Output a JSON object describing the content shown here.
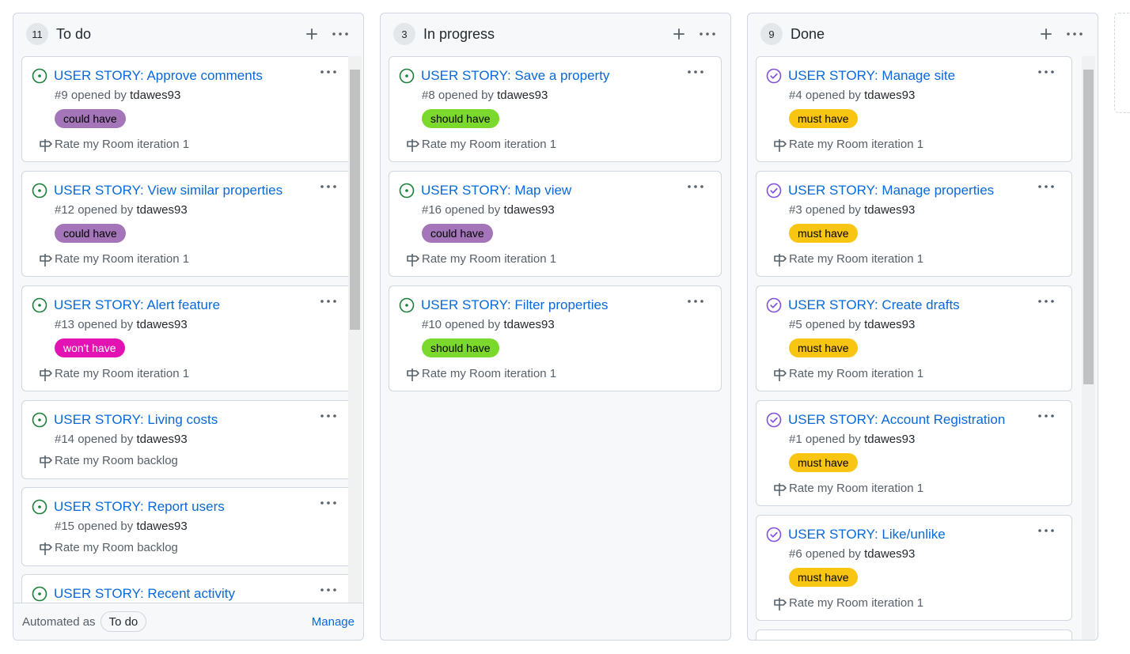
{
  "columns": [
    {
      "count": "11",
      "title": "To do",
      "cards": [
        {
          "title": "USER STORY: Approve comments",
          "number": "#9",
          "opened_by": "opened by",
          "author": "tdawes93",
          "label": "could have",
          "label_bg": "#a475b9",
          "label_color": "#000000",
          "milestone": "Rate my Room iteration 1",
          "state": "open"
        },
        {
          "title": "USER STORY: View similar properties",
          "number": "#12",
          "opened_by": "opened by",
          "author": "tdawes93",
          "label": "could have",
          "label_bg": "#a475b9",
          "label_color": "#000000",
          "milestone": "Rate my Room iteration 1",
          "state": "open"
        },
        {
          "title": "USER STORY: Alert feature",
          "number": "#13",
          "opened_by": "opened by",
          "author": "tdawes93",
          "label": "won't have",
          "label_bg": "#e313b3",
          "label_color": "#ffffff",
          "milestone": "Rate my Room iteration 1",
          "state": "open"
        },
        {
          "title": "USER STORY: Living costs",
          "number": "#14",
          "opened_by": "opened by",
          "author": "tdawes93",
          "label": "",
          "milestone": "Rate my Room backlog",
          "state": "open"
        },
        {
          "title": "USER STORY: Report users",
          "number": "#15",
          "opened_by": "opened by",
          "author": "tdawes93",
          "label": "",
          "milestone": "Rate my Room backlog",
          "state": "open"
        },
        {
          "title": "USER STORY: Recent activity",
          "number": "",
          "opened_by": "",
          "author": "",
          "label": "",
          "milestone": "",
          "state": "open"
        }
      ],
      "footer": {
        "automated_as": "Automated as",
        "automation": "To do",
        "manage": "Manage"
      }
    },
    {
      "count": "3",
      "title": "In progress",
      "cards": [
        {
          "title": "USER STORY: Save a property",
          "number": "#8",
          "opened_by": "opened by",
          "author": "tdawes93",
          "label": "should have",
          "label_bg": "#7bd82c",
          "label_color": "#000000",
          "milestone": "Rate my Room iteration 1",
          "state": "open"
        },
        {
          "title": "USER STORY: Map view",
          "number": "#16",
          "opened_by": "opened by",
          "author": "tdawes93",
          "label": "could have",
          "label_bg": "#a475b9",
          "label_color": "#000000",
          "milestone": "Rate my Room iteration 1",
          "state": "open"
        },
        {
          "title": "USER STORY: Filter properties",
          "number": "#10",
          "opened_by": "opened by",
          "author": "tdawes93",
          "label": "should have",
          "label_bg": "#7bd82c",
          "label_color": "#000000",
          "milestone": "Rate my Room iteration 1",
          "state": "open"
        }
      ]
    },
    {
      "count": "9",
      "title": "Done",
      "cards": [
        {
          "title": "USER STORY: Manage site",
          "number": "#4",
          "opened_by": "opened by",
          "author": "tdawes93",
          "label": "must have",
          "label_bg": "#f9c513",
          "label_color": "#000000",
          "milestone": "Rate my Room iteration 1",
          "state": "closed"
        },
        {
          "title": "USER STORY: Manage properties",
          "number": "#3",
          "opened_by": "opened by",
          "author": "tdawes93",
          "label": "must have",
          "label_bg": "#f9c513",
          "label_color": "#000000",
          "milestone": "Rate my Room iteration 1",
          "state": "closed"
        },
        {
          "title": "USER STORY: Create drafts",
          "number": "#5",
          "opened_by": "opened by",
          "author": "tdawes93",
          "label": "must have",
          "label_bg": "#f9c513",
          "label_color": "#000000",
          "milestone": "Rate my Room iteration 1",
          "state": "closed"
        },
        {
          "title": "USER STORY: Account Registration",
          "number": "#1",
          "opened_by": "opened by",
          "author": "tdawes93",
          "label": "must have",
          "label_bg": "#f9c513",
          "label_color": "#000000",
          "milestone": "Rate my Room iteration 1",
          "state": "closed"
        },
        {
          "title": "USER STORY: Like/unlike",
          "number": "#6",
          "opened_by": "opened by",
          "author": "tdawes93",
          "label": "must have",
          "label_bg": "#f9c513",
          "label_color": "#000000",
          "milestone": "Rate my Room iteration 1",
          "state": "closed"
        }
      ]
    }
  ],
  "icons": {
    "open_issue": "issue-opened-icon",
    "closed_issue": "issue-closed-icon",
    "milestone": "milestone-icon",
    "add": "plus-icon",
    "more": "kebab-horizontal-icon"
  },
  "colors": {
    "open_issue": "#1a7f37",
    "closed_issue": "#8250df",
    "link": "#0969da"
  }
}
